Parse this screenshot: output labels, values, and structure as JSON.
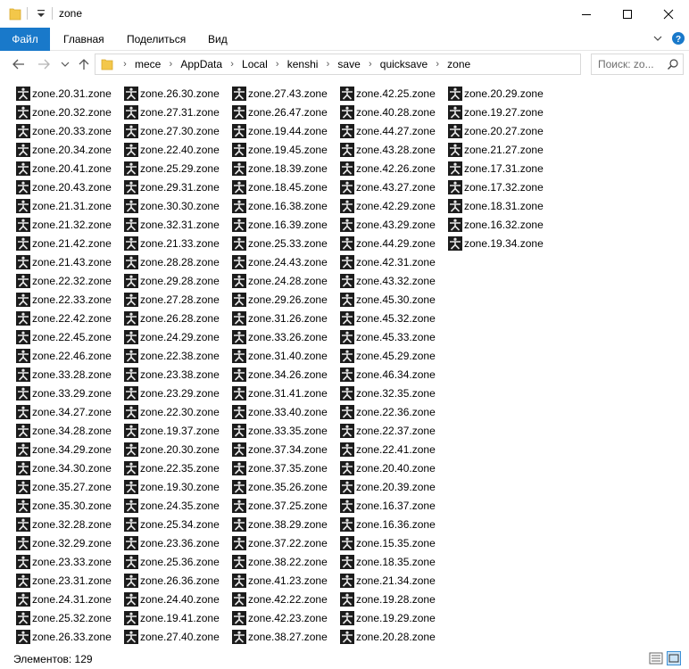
{
  "window": {
    "title": "zone"
  },
  "ribbon": {
    "tabs": [
      {
        "label": "Файл",
        "active": true
      },
      {
        "label": "Главная",
        "active": false
      },
      {
        "label": "Поделиться",
        "active": false
      },
      {
        "label": "Вид",
        "active": false
      }
    ]
  },
  "address": {
    "crumbs": [
      "mece",
      "AppData",
      "Local",
      "kenshi",
      "save",
      "quicksave",
      "zone"
    ]
  },
  "search": {
    "placeholder": "Поиск: zo..."
  },
  "files": {
    "columns": [
      [
        "zone.20.31.zone",
        "zone.20.32.zone",
        "zone.20.33.zone",
        "zone.20.34.zone",
        "zone.20.41.zone",
        "zone.20.43.zone",
        "zone.21.31.zone",
        "zone.21.32.zone",
        "zone.21.42.zone",
        "zone.21.43.zone",
        "zone.22.32.zone",
        "zone.22.33.zone",
        "zone.22.42.zone",
        "zone.22.45.zone",
        "zone.22.46.zone",
        "zone.33.28.zone",
        "zone.33.29.zone",
        "zone.34.27.zone",
        "zone.34.28.zone",
        "zone.34.29.zone",
        "zone.34.30.zone",
        "zone.35.27.zone",
        "zone.35.30.zone",
        "zone.32.28.zone",
        "zone.32.29.zone",
        "zone.23.33.zone",
        "zone.23.31.zone",
        "zone.24.31.zone",
        "zone.25.32.zone",
        "zone.26.33.zone"
      ],
      [
        "zone.26.30.zone",
        "zone.27.31.zone",
        "zone.27.30.zone",
        "zone.22.40.zone",
        "zone.25.29.zone",
        "zone.29.31.zone",
        "zone.30.30.zone",
        "zone.32.31.zone",
        "zone.21.33.zone",
        "zone.28.28.zone",
        "zone.29.28.zone",
        "zone.27.28.zone",
        "zone.26.28.zone",
        "zone.24.29.zone",
        "zone.22.38.zone",
        "zone.23.38.zone",
        "zone.23.29.zone",
        "zone.22.30.zone",
        "zone.19.37.zone",
        "zone.20.30.zone",
        "zone.22.35.zone",
        "zone.19.30.zone",
        "zone.24.35.zone",
        "zone.25.34.zone",
        "zone.23.36.zone",
        "zone.25.36.zone",
        "zone.26.36.zone",
        "zone.24.40.zone",
        "zone.19.41.zone",
        "zone.27.40.zone"
      ],
      [
        "zone.27.43.zone",
        "zone.26.47.zone",
        "zone.19.44.zone",
        "zone.19.45.zone",
        "zone.18.39.zone",
        "zone.18.45.zone",
        "zone.16.38.zone",
        "zone.16.39.zone",
        "zone.25.33.zone",
        "zone.24.43.zone",
        "zone.24.28.zone",
        "zone.29.26.zone",
        "zone.31.26.zone",
        "zone.33.26.zone",
        "zone.31.40.zone",
        "zone.34.26.zone",
        "zone.31.41.zone",
        "zone.33.40.zone",
        "zone.33.35.zone",
        "zone.37.34.zone",
        "zone.37.35.zone",
        "zone.35.26.zone",
        "zone.37.25.zone",
        "zone.38.29.zone",
        "zone.37.22.zone",
        "zone.38.22.zone",
        "zone.41.23.zone",
        "zone.42.22.zone",
        "zone.42.23.zone",
        "zone.38.27.zone"
      ],
      [
        "zone.42.25.zone",
        "zone.40.28.zone",
        "zone.44.27.zone",
        "zone.43.28.zone",
        "zone.42.26.zone",
        "zone.43.27.zone",
        "zone.42.29.zone",
        "zone.43.29.zone",
        "zone.44.29.zone",
        "zone.42.31.zone",
        "zone.43.32.zone",
        "zone.45.30.zone",
        "zone.45.32.zone",
        "zone.45.33.zone",
        "zone.45.29.zone",
        "zone.46.34.zone",
        "zone.32.35.zone",
        "zone.22.36.zone",
        "zone.22.37.zone",
        "zone.22.41.zone",
        "zone.20.40.zone",
        "zone.20.39.zone",
        "zone.16.37.zone",
        "zone.16.36.zone",
        "zone.15.35.zone",
        "zone.18.35.zone",
        "zone.21.34.zone",
        "zone.19.28.zone",
        "zone.19.29.zone",
        "zone.20.28.zone"
      ],
      [
        "zone.20.29.zone",
        "zone.19.27.zone",
        "zone.20.27.zone",
        "zone.21.27.zone",
        "zone.17.31.zone",
        "zone.17.32.zone",
        "zone.18.31.zone",
        "zone.16.32.zone",
        "zone.19.34.zone"
      ]
    ]
  },
  "status": {
    "item_count": "Элементов: 129"
  },
  "colors": {
    "accent": "#1979ca",
    "folder": "#f3c74a",
    "file_icon_bg": "#1c1c1c"
  }
}
